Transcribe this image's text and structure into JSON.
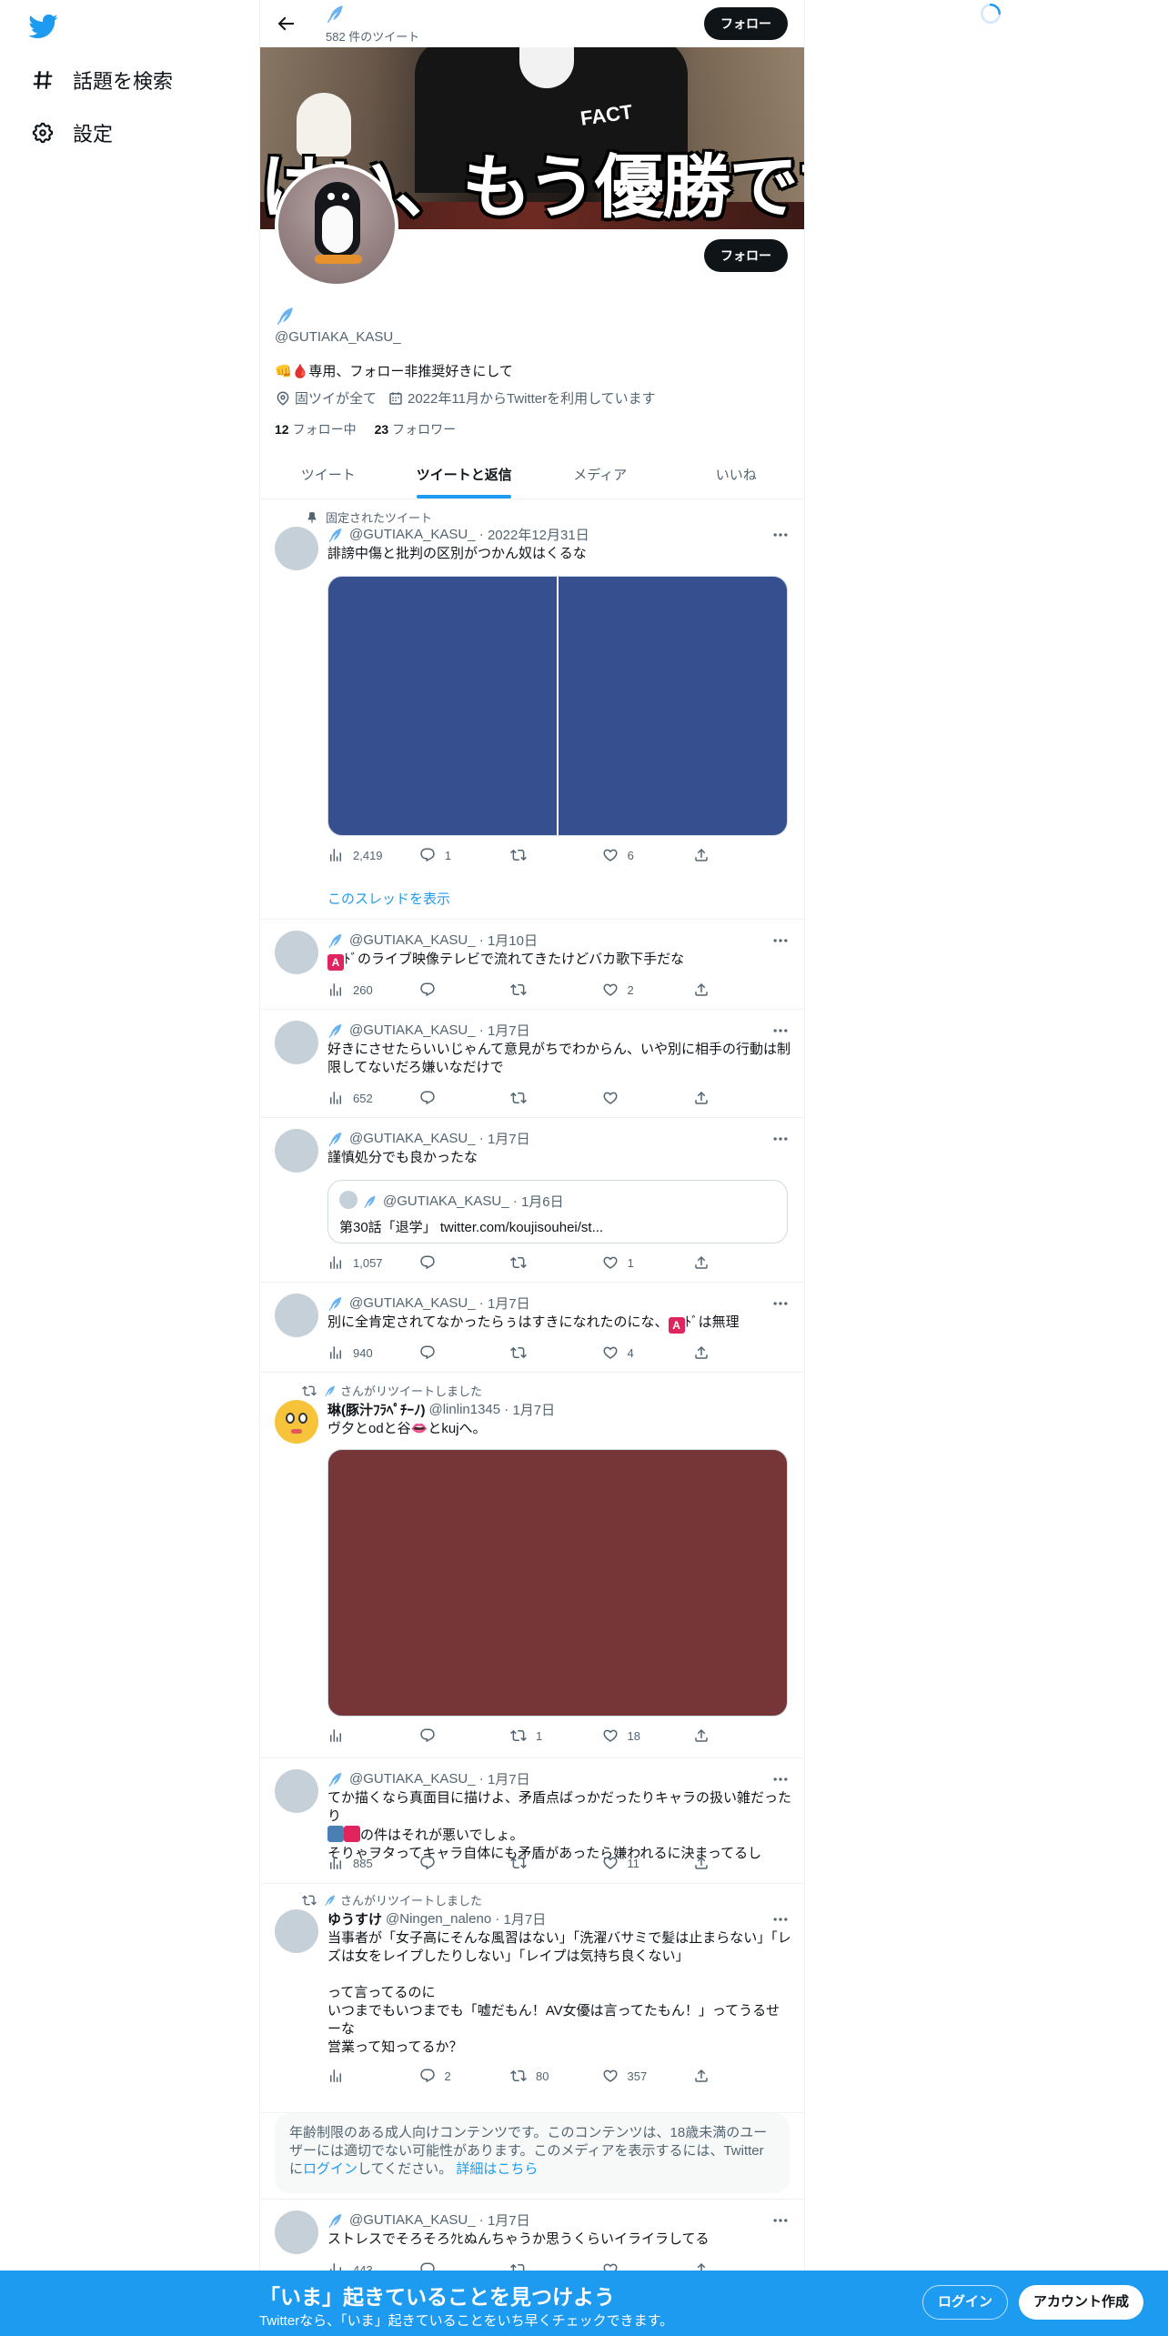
{
  "nav": {
    "explore_label": "話題を検索",
    "settings_label": "設定"
  },
  "header": {
    "tweet_count": "582 件のツイート",
    "follow_label": "フォロー"
  },
  "banner": {
    "text": "はい、もう優勝です。",
    "shirt_text": "FACT"
  },
  "profile": {
    "handle": "@GUTIAKA_KASU_",
    "bio": "👊🩸専用、フォロー非推奨好きにして",
    "location": "固ツイが全て",
    "joined": "2022年11月からTwitterを利用しています",
    "following_count": "12",
    "following_label": "フォロー中",
    "followers_count": "23",
    "followers_label": "フォロワー",
    "follow_label": "フォロー"
  },
  "tabs": [
    "ツイート",
    "ツイートと返信",
    "メディア",
    "いいね"
  ],
  "tweets": {
    "t1": {
      "pinned_label": "固定されたツイート",
      "handle": "@GUTIAKA_KASU_",
      "date": "2022年12月31日",
      "text": "誹謗中傷と批判の区別がつかん奴はくるな",
      "views": "2,419",
      "replies": "1",
      "retweets": "",
      "likes": "6",
      "thread_link": "このスレッドを表示",
      "media_color": "#36508f"
    },
    "t2": {
      "handle": "@GUTIAKA_KASU_",
      "date": "1月10日",
      "text_after_badge": "ﾄﾞのライブ映像テレビで流れてきたけどバカ歌下手だな",
      "badge": "A",
      "views": "260",
      "replies": "",
      "retweets": "",
      "likes": "2"
    },
    "t3": {
      "handle": "@GUTIAKA_KASU_",
      "date": "1月7日",
      "text": "好きにさせたらいいじゃんて意見がちでわからん、いや別に相手の行動は制限してないだろ嫌いなだけで",
      "views": "652",
      "replies": "",
      "retweets": "",
      "likes": ""
    },
    "t4": {
      "handle": "@GUTIAKA_KASU_",
      "date": "1月7日",
      "text": "謹慎処分でも良かったな",
      "quote_handle": "@GUTIAKA_KASU_",
      "quote_date": "1月6日",
      "quote_text": "第30話「退学」 twitter.com/koujisouhei/st...",
      "views": "1,057",
      "replies": "",
      "retweets": "",
      "likes": "1"
    },
    "t5": {
      "handle": "@GUTIAKA_KASU_",
      "date": "1月7日",
      "text_before_badge": "別に全肯定されてなかったらぅはすきになれたのにな、",
      "badge": "A",
      "text_after_badge": "ﾄﾞは無理",
      "views": "940",
      "replies": "",
      "retweets": "",
      "likes": "4"
    },
    "t6": {
      "rt_label": "さんがリツイートしました",
      "name": "琳(豚汁ﾌﾗﾍﾟﾁｰﾉ)",
      "handle": "@linlin1345",
      "date": "1月7日",
      "text": "ヴ夕とodと谷👄とkujへ。",
      "views": "",
      "replies": "",
      "retweets": "1",
      "likes": "18",
      "media_color": "#763537"
    },
    "t7": {
      "handle": "@GUTIAKA_KASU_",
      "date": "1月7日",
      "line1": "てか描くなら真面目に描けよ、矛盾点ばっかだったりキャラの扱い雑だったり",
      "line2_after": "の件はそれが悪いでしょ。",
      "line3": "そりゃヲタってキャラ自体にも矛盾があったら嫌われるに決まってるし",
      "views": "885",
      "replies": "",
      "retweets": "",
      "likes": "11"
    },
    "t8": {
      "rt_label": "さんがリツイートしました",
      "name": "ゆうすけ",
      "handle": "@Ningen_naleno",
      "date": "1月7日",
      "text": "当事者が「女子高にそんな風習はない」「洗濯バサミで髪は止まらない」「レズは女をレイプしたりしない」「レイプは気持ち良くない」\n\nって言ってるのに\nいつまでもいつまでも「嘘だもん！AV女優は言ってたもん！」ってうるせーな\n営業って知ってるか？",
      "views": "",
      "replies": "2",
      "retweets": "80",
      "likes": "357"
    },
    "sensitive": {
      "text_1": "年齢制限のある成人向けコンテンツです。このコンテンツは、18歳未満のユーザーには適切でない可能性があります。このメディアを表示するには、Twitterに",
      "login_link": "ログイン",
      "text_2": "してください。",
      "details_link": "詳細はこちら"
    },
    "t9": {
      "handle": "@GUTIAKA_KASU_",
      "date": "1月7日",
      "text": "ストレスでそろそろｸﾋぬんちゃうか思うくらいイライラしてる",
      "views": "443"
    }
  },
  "bottom_bar": {
    "title": "「いま」起きていることを見つけよう",
    "subtitle": "Twitterなら、「いま」起きていることをいち早くチェックできます。",
    "login_label": "ログイン",
    "signup_label": "アカウント作成"
  },
  "colors": {
    "accent": "#1d9bf0",
    "text_primary": "#0f1419",
    "text_secondary": "#536471"
  }
}
